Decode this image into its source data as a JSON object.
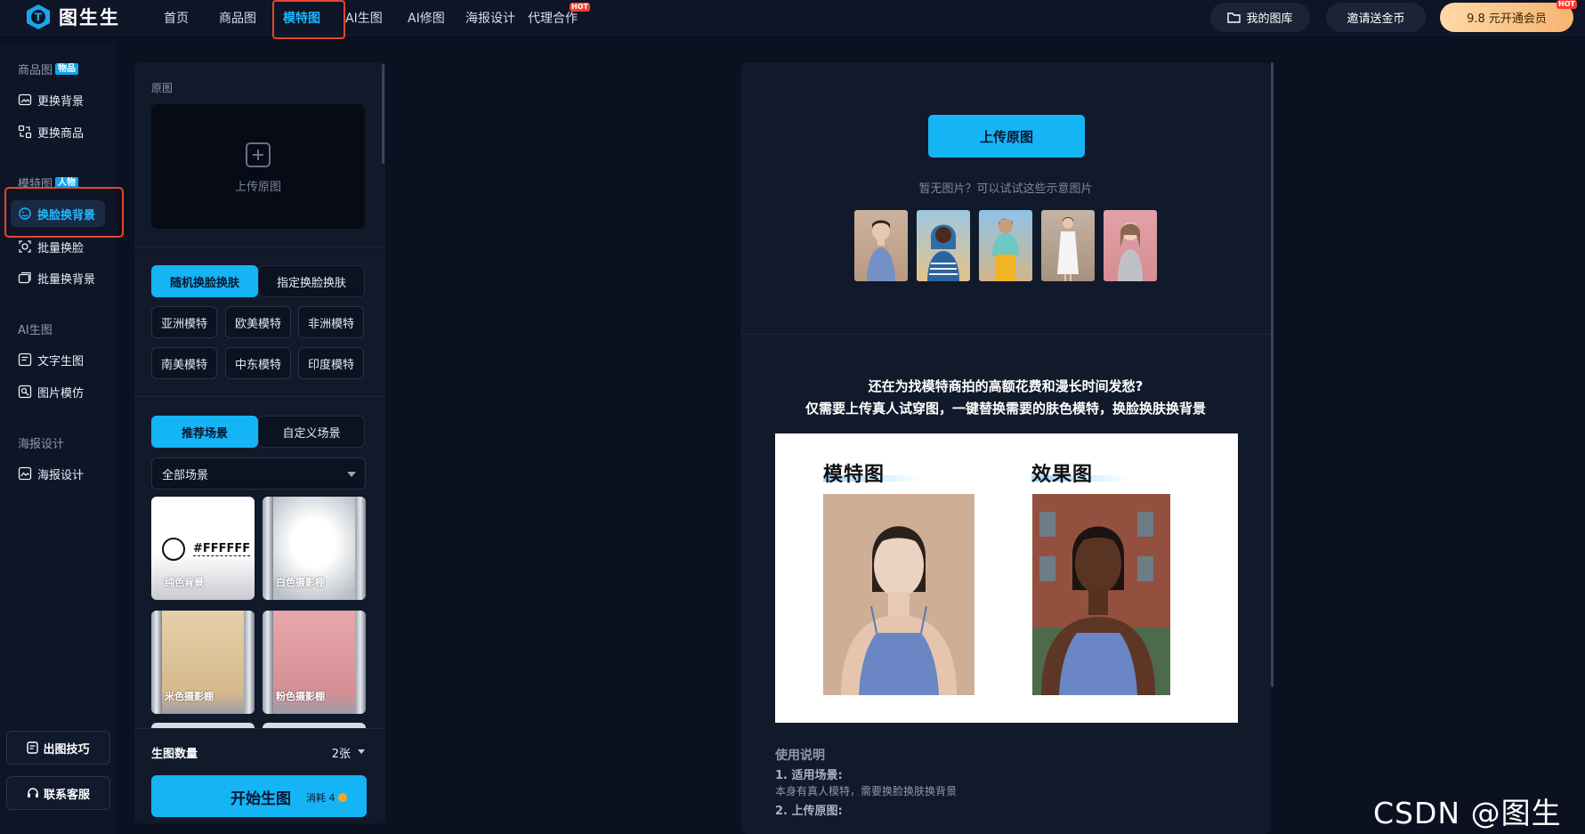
{
  "brand": {
    "name": "图生生"
  },
  "nav": {
    "items": [
      {
        "label": "首页"
      },
      {
        "label": "商品图"
      },
      {
        "label": "模特图"
      },
      {
        "label": "AI生图"
      },
      {
        "label": "AI修图"
      },
      {
        "label": "海报设计"
      },
      {
        "label": "代理合作",
        "badge": "HOT"
      }
    ],
    "active": "模特图",
    "gallery": "我的图库",
    "invite": "邀请送金币",
    "vip": "9.8 元开通会员",
    "vip_badge": "HOT"
  },
  "sidebar": {
    "sections": [
      {
        "title": "商品图",
        "tag": "物品"
      },
      {
        "title": "模特图",
        "tag": "人物"
      },
      {
        "title": "AI生图"
      },
      {
        "title": "海报设计"
      }
    ],
    "items": [
      {
        "label": "更换背景",
        "icon": "image-swap-icon"
      },
      {
        "label": "更换商品",
        "icon": "product-swap-icon"
      },
      {
        "label": "换脸换背景",
        "icon": "face-swap-icon",
        "active": true
      },
      {
        "label": "批量换脸",
        "icon": "batch-face-icon"
      },
      {
        "label": "批量换背景",
        "icon": "batch-bg-icon"
      },
      {
        "label": "文字生图",
        "icon": "text-image-icon"
      },
      {
        "label": "图片模仿",
        "icon": "image-mimic-icon"
      },
      {
        "label": "海报设计",
        "icon": "poster-icon"
      }
    ],
    "tips": "出图技巧",
    "support": "联系客服"
  },
  "panel": {
    "original_label": "原图",
    "upload_text": "上传原图",
    "mode_tabs": [
      "随机换脸换肤",
      "指定换脸换肤"
    ],
    "models": [
      "亚洲模特",
      "欧美模特",
      "非洲模特",
      "南美模特",
      "中东模特",
      "印度模特"
    ],
    "scene_tabs": [
      "推荐场景",
      "自定义场景"
    ],
    "scene_filter": "全部场景",
    "scenes": [
      {
        "caption": "纯色背景",
        "hex": "#FFFFFF"
      },
      {
        "caption": "白色摄影棚"
      },
      {
        "caption": "米色摄影棚"
      },
      {
        "caption": "粉色摄影棚"
      }
    ],
    "count_label": "生图数量",
    "count_value": "2张",
    "start": "开始生图",
    "cost": "消耗 4"
  },
  "main": {
    "upload_button": "上传原图",
    "hint": "暂无图片？可以试试这些示意图片",
    "headline1": "还在为找模特商拍的高额花费和漫长时间发愁?",
    "headline2": "仅需要上传真人试穿图，一键替换需要的肤色模特，换脸换肤换背景",
    "compare_left": "模特图",
    "compare_right": "效果图",
    "usage_title": "使用说明",
    "usage_1_title": "1. 适用场景:",
    "usage_1_text": "本身有真人模特，需要换脸换肤换背景",
    "usage_2_title": "2. 上传原图:"
  },
  "watermark": "CSDN @图生生",
  "colors": {
    "accent": "#14b4f5",
    "highlight": "#e8452c",
    "bg": "#0b1120"
  }
}
